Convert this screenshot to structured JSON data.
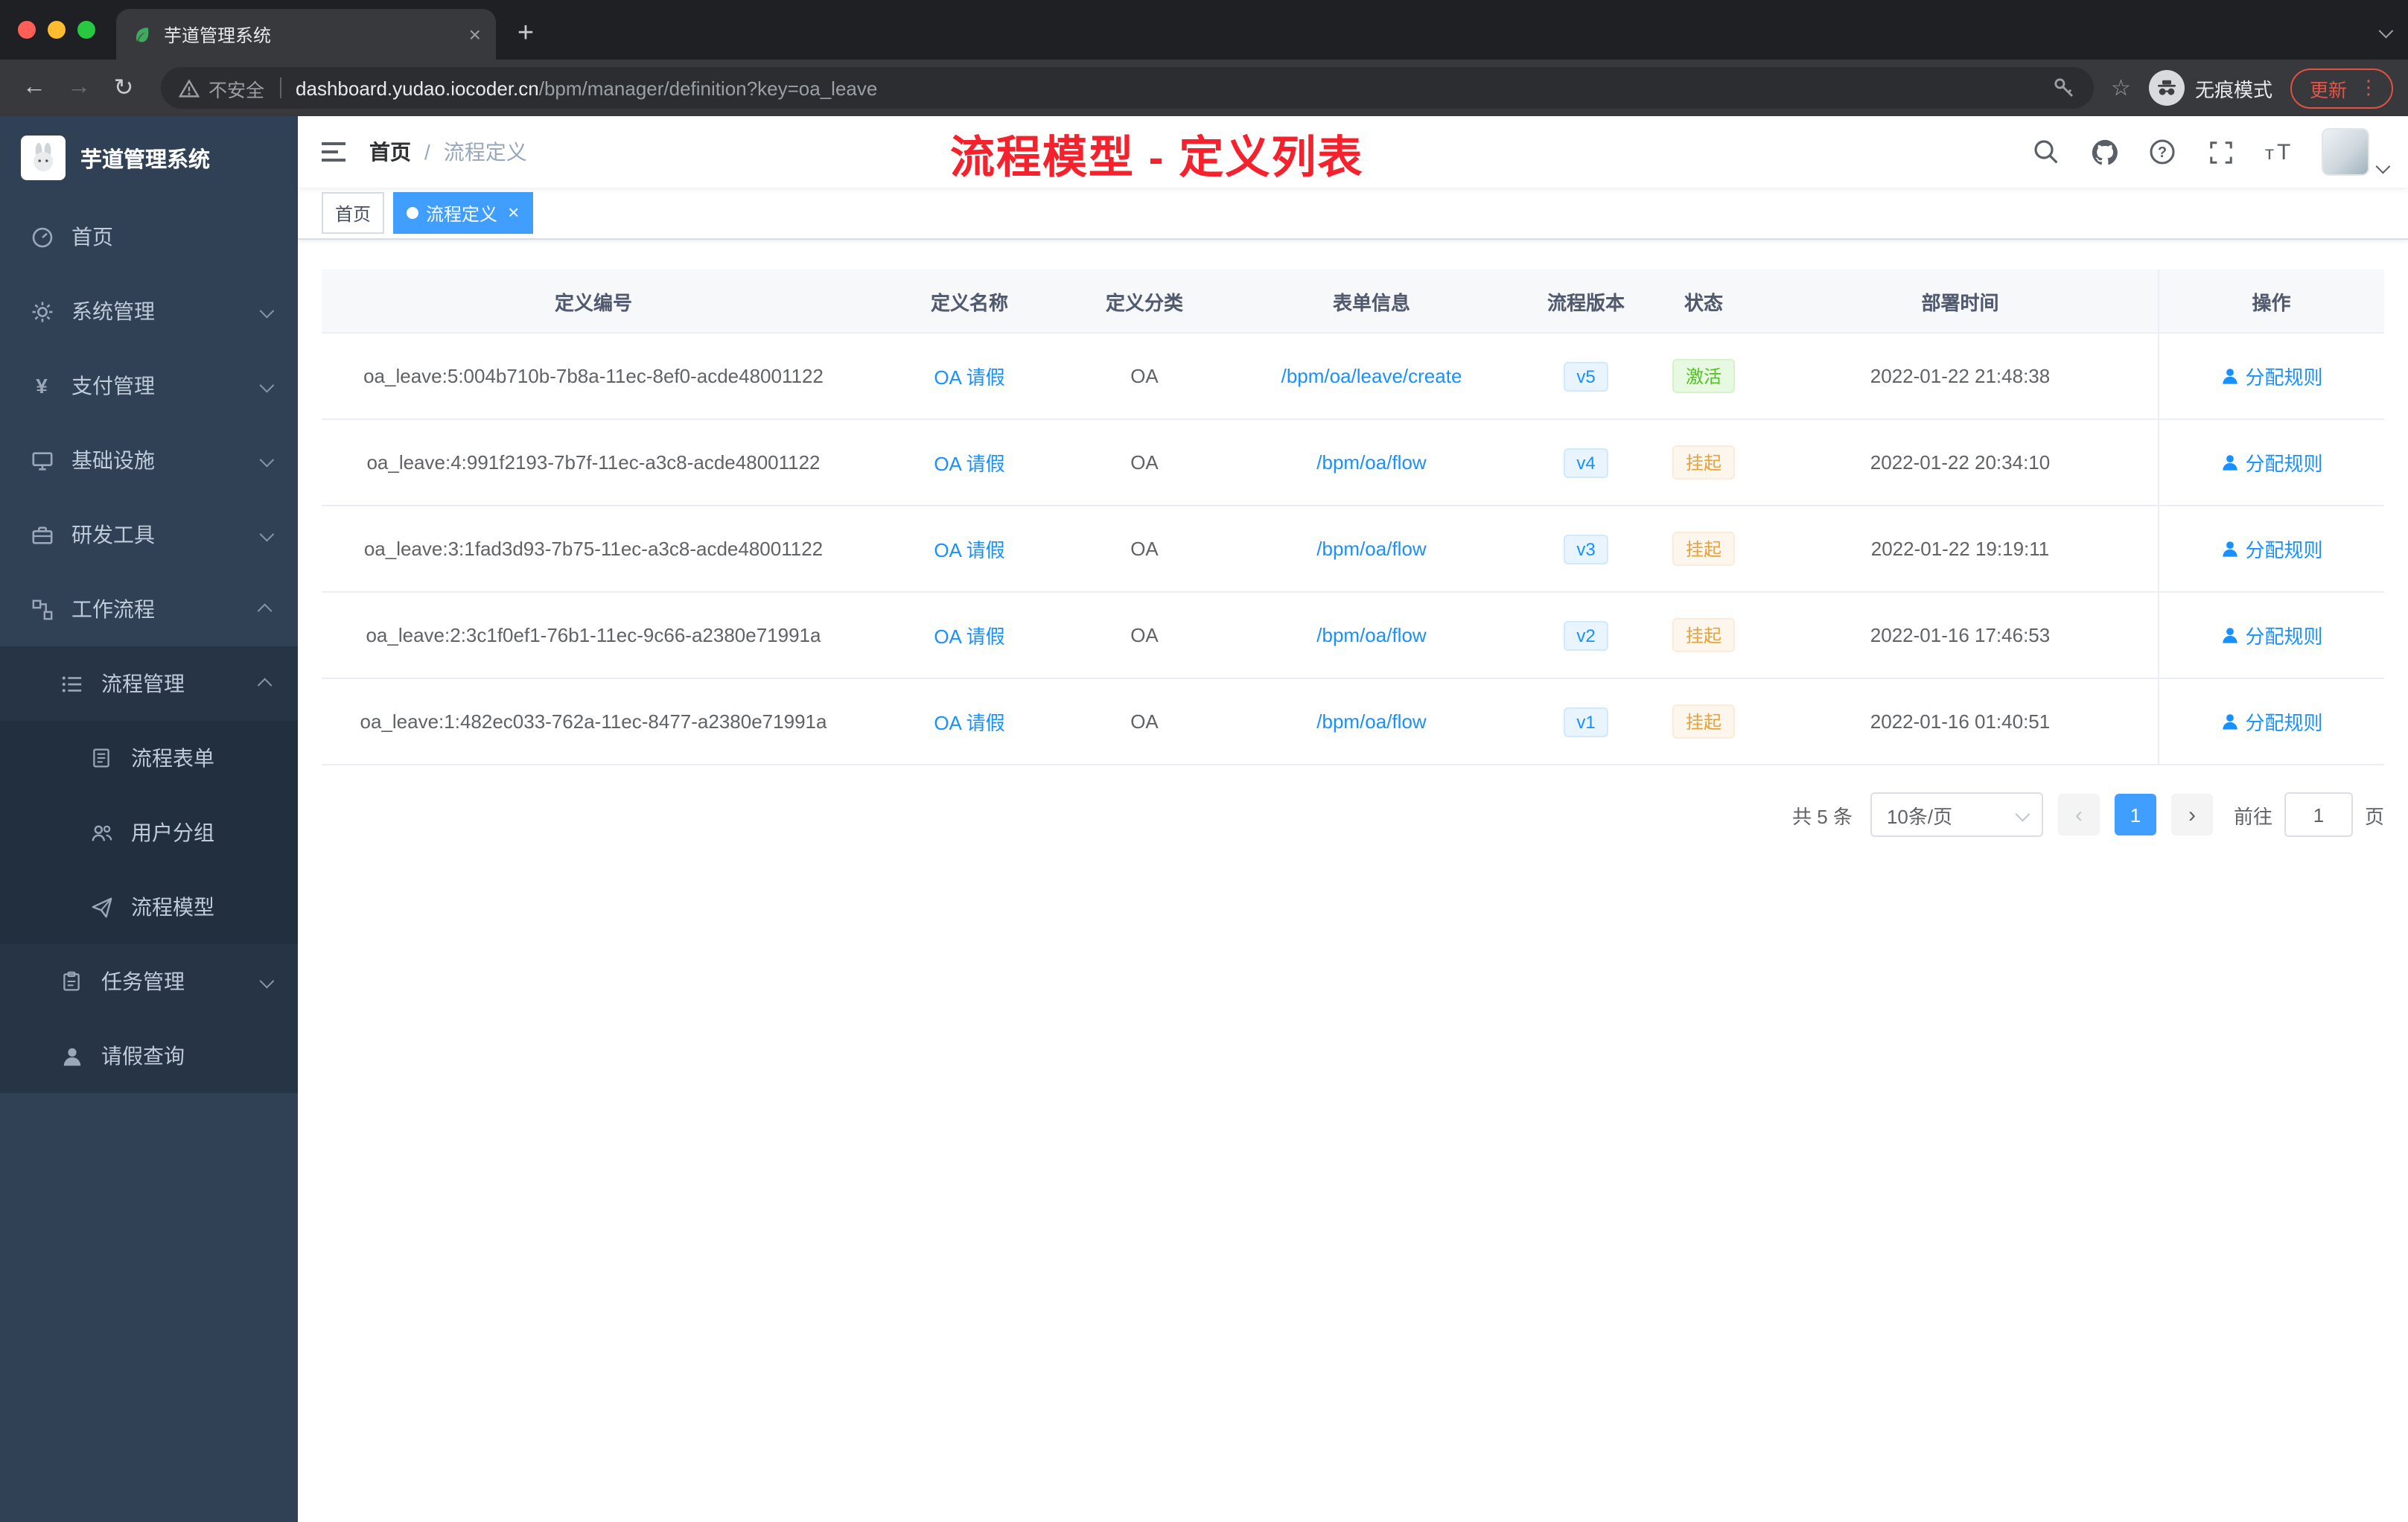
{
  "browser": {
    "tab_title": "芋道管理系统",
    "tab_close": "×",
    "new_tab": "+",
    "back": "←",
    "forward": "→",
    "reload": "↻",
    "security_warning": "不安全",
    "url_domain": "dashboard.yudao.iocoder.cn",
    "url_path": "/bpm/manager/definition?key=oa_leave",
    "star": "☆",
    "incognito_label": "无痕模式",
    "update_label": "更新",
    "menu_dots": "⋮"
  },
  "sidebar": {
    "logo_title": "芋道管理系统",
    "items": [
      {
        "label": "首页"
      },
      {
        "label": "系统管理"
      },
      {
        "label": "支付管理"
      },
      {
        "label": "基础设施"
      },
      {
        "label": "研发工具"
      },
      {
        "label": "工作流程"
      },
      {
        "label": "流程管理"
      },
      {
        "label": "流程表单"
      },
      {
        "label": "用户分组"
      },
      {
        "label": "流程模型"
      },
      {
        "label": "任务管理"
      },
      {
        "label": "请假查询"
      }
    ]
  },
  "navbar": {
    "breadcrumb_home": "首页",
    "breadcrumb_sep": "/",
    "breadcrumb_current": "流程定义",
    "annotation": "流程模型 - 定义列表"
  },
  "tags": {
    "home": "首页",
    "current": "流程定义",
    "close": "×"
  },
  "table": {
    "headers": {
      "id": "定义编号",
      "name": "定义名称",
      "category": "定义分类",
      "form": "表单信息",
      "version": "流程版本",
      "status": "状态",
      "deploy_time": "部署时间",
      "action": "操作"
    },
    "action_label": "分配规则",
    "rows": [
      {
        "id": "oa_leave:5:004b710b-7b8a-11ec-8ef0-acde48001122",
        "name": "OA 请假",
        "category": "OA",
        "form": "/bpm/oa/leave/create",
        "version": "v5",
        "status": "激活",
        "deploy_time": "2022-01-22 21:48:38"
      },
      {
        "id": "oa_leave:4:991f2193-7b7f-11ec-a3c8-acde48001122",
        "name": "OA 请假",
        "category": "OA",
        "form": "/bpm/oa/flow",
        "version": "v4",
        "status": "挂起",
        "deploy_time": "2022-01-22 20:34:10"
      },
      {
        "id": "oa_leave:3:1fad3d93-7b75-11ec-a3c8-acde48001122",
        "name": "OA 请假",
        "category": "OA",
        "form": "/bpm/oa/flow",
        "version": "v3",
        "status": "挂起",
        "deploy_time": "2022-01-22 19:19:11"
      },
      {
        "id": "oa_leave:2:3c1f0ef1-76b1-11ec-9c66-a2380e71991a",
        "name": "OA 请假",
        "category": "OA",
        "form": "/bpm/oa/flow",
        "version": "v2",
        "status": "挂起",
        "deploy_time": "2022-01-16 17:46:53"
      },
      {
        "id": "oa_leave:1:482ec033-762a-11ec-8477-a2380e71991a",
        "name": "OA 请假",
        "category": "OA",
        "form": "/bpm/oa/flow",
        "version": "v1",
        "status": "挂起",
        "deploy_time": "2022-01-16 01:40:51"
      }
    ]
  },
  "pagination": {
    "total": "共 5 条",
    "page_size": "10条/页",
    "prev": "‹",
    "page": "1",
    "next": "›",
    "goto_label": "前往",
    "goto_value": "1",
    "goto_unit": "页"
  },
  "colors": {
    "accent_blue": "#409eff",
    "link_blue": "#1890ff",
    "success_green": "#4fc322",
    "warning_orange": "#e6a23c",
    "sidebar_bg": "#304156",
    "annotation_red": "#f5222d"
  }
}
